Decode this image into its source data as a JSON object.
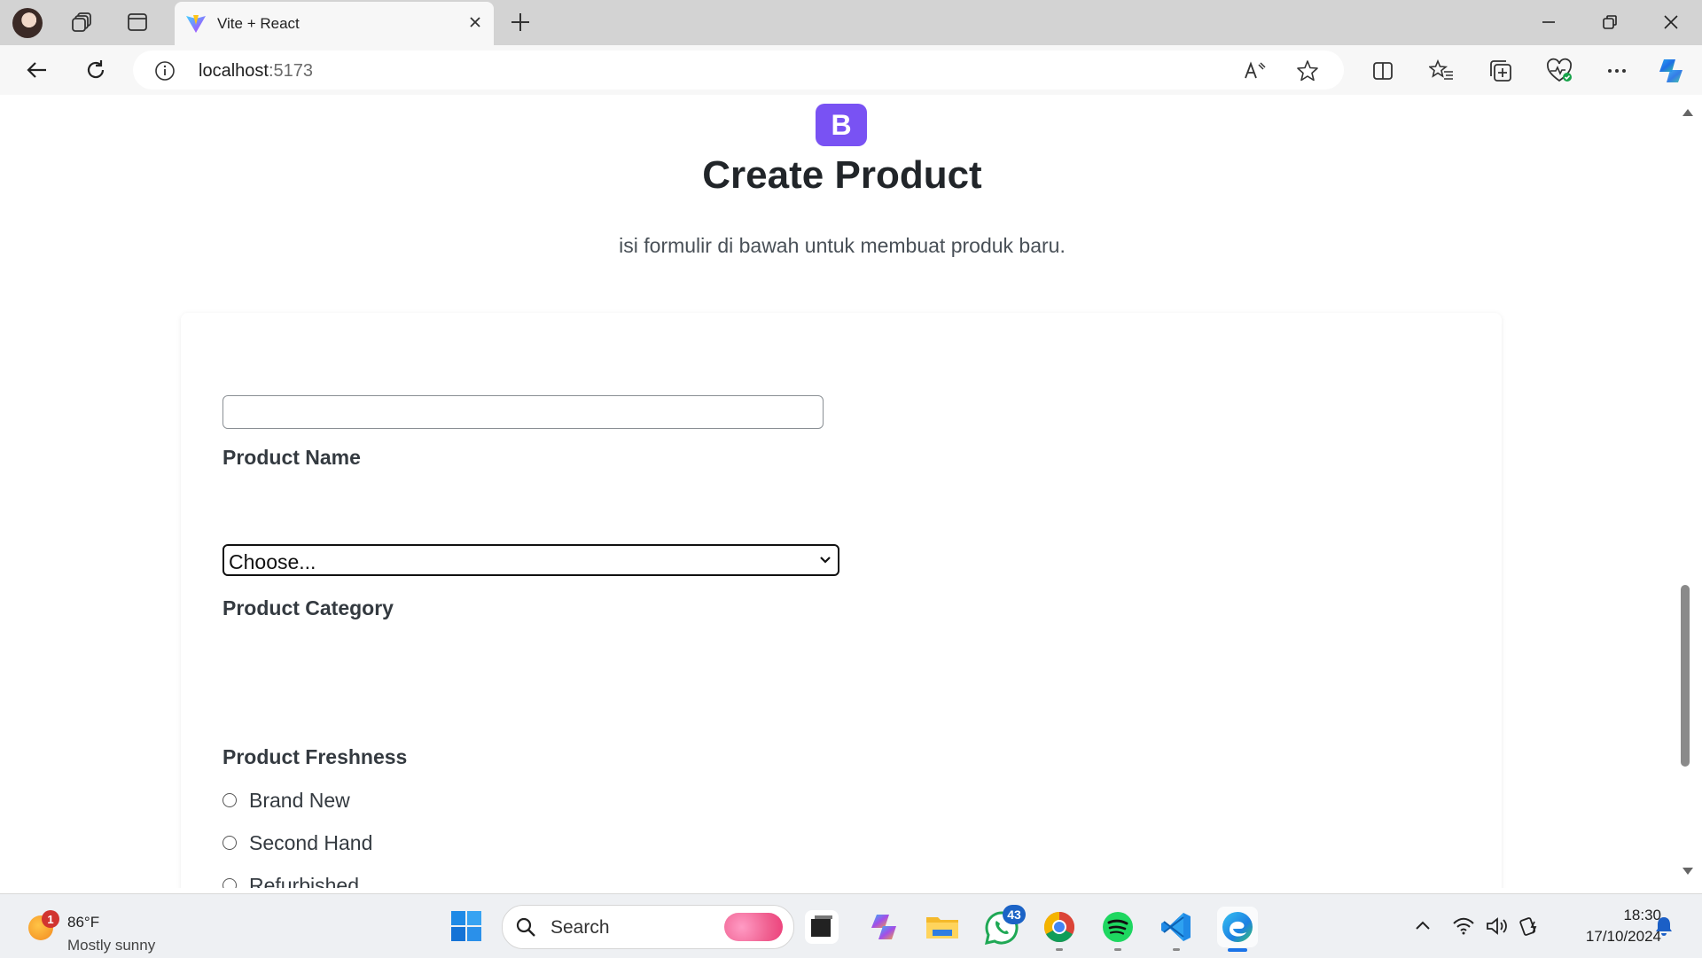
{
  "browser": {
    "tab": {
      "title": "Vite + React"
    },
    "address": {
      "host": "localhost",
      "port": ":5173"
    }
  },
  "page": {
    "logo_letter": "B",
    "title": "Create Product",
    "subtitle": "isi formulir di bawah untuk membuat produk baru.",
    "form": {
      "name_label": "Product Name",
      "name_value": "",
      "category_label": "Product Category",
      "category_selected": "Choose...",
      "freshness_label": "Product Freshness",
      "freshness_options": [
        "Brand New",
        "Second Hand",
        "Refurbished"
      ]
    },
    "colors": {
      "brand": "#7952f3"
    }
  },
  "taskbar": {
    "weather": {
      "temp": "86°F",
      "condition": "Mostly sunny",
      "badge": "1"
    },
    "search_label": "Search",
    "whatsapp_badge": "43",
    "clock": {
      "time": "18:30",
      "date": "17/10/2024"
    }
  }
}
